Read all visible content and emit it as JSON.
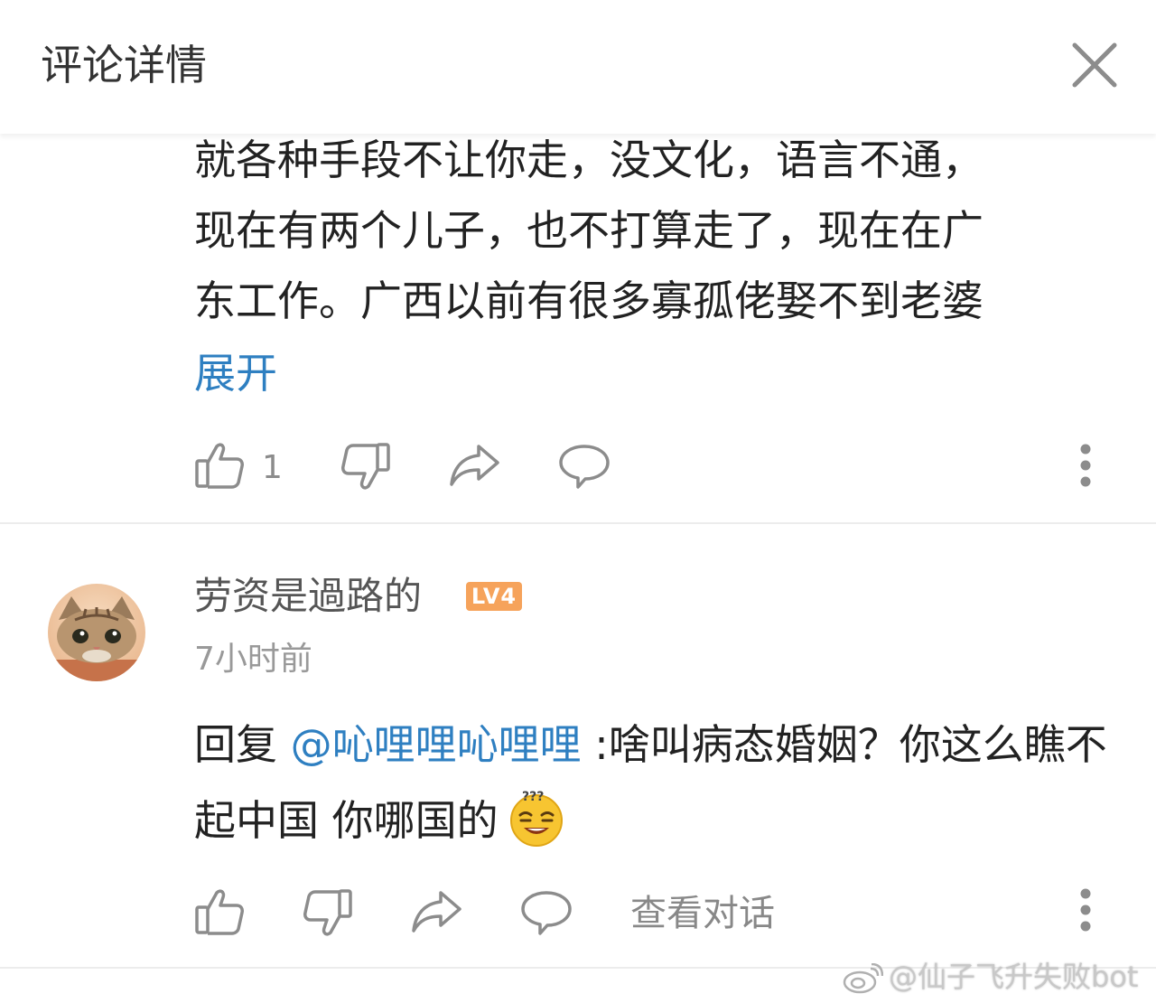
{
  "header": {
    "title": "评论详情",
    "close_icon": "close-icon"
  },
  "comment1": {
    "text_lines": [
      "就各种手段不让你走，没文化，语言不通，",
      "现在有两个儿子，也不打算走了，现在在广",
      "东工作。广西以前有很多寡孤佬娶不到老婆"
    ],
    "expand_label": "展开",
    "like_count": "1",
    "icons": [
      "like-icon",
      "dislike-icon",
      "share-icon",
      "comment-icon",
      "more-icon"
    ]
  },
  "comment2": {
    "username": "劳资是過路的",
    "level": "LV4",
    "time": "7小时前",
    "reply_prefix": "回复",
    "mention": "@吣哩哩吣哩哩",
    "reply_text": ":啥叫病态婚姻？你这么瞧不起中国  你哪国的",
    "emoji": "confused-grin-emoji",
    "view_conversation": "查看对话",
    "icons": [
      "like-icon",
      "dislike-icon",
      "share-icon",
      "comment-icon",
      "more-icon"
    ]
  },
  "watermark": {
    "text": "@仙子飞升失败bot",
    "icon": "weibo-icon"
  },
  "colors": {
    "link": "#2e7fc1",
    "badge": "#f6a35b",
    "icon": "#8c8c8c",
    "divider": "#ececec"
  }
}
